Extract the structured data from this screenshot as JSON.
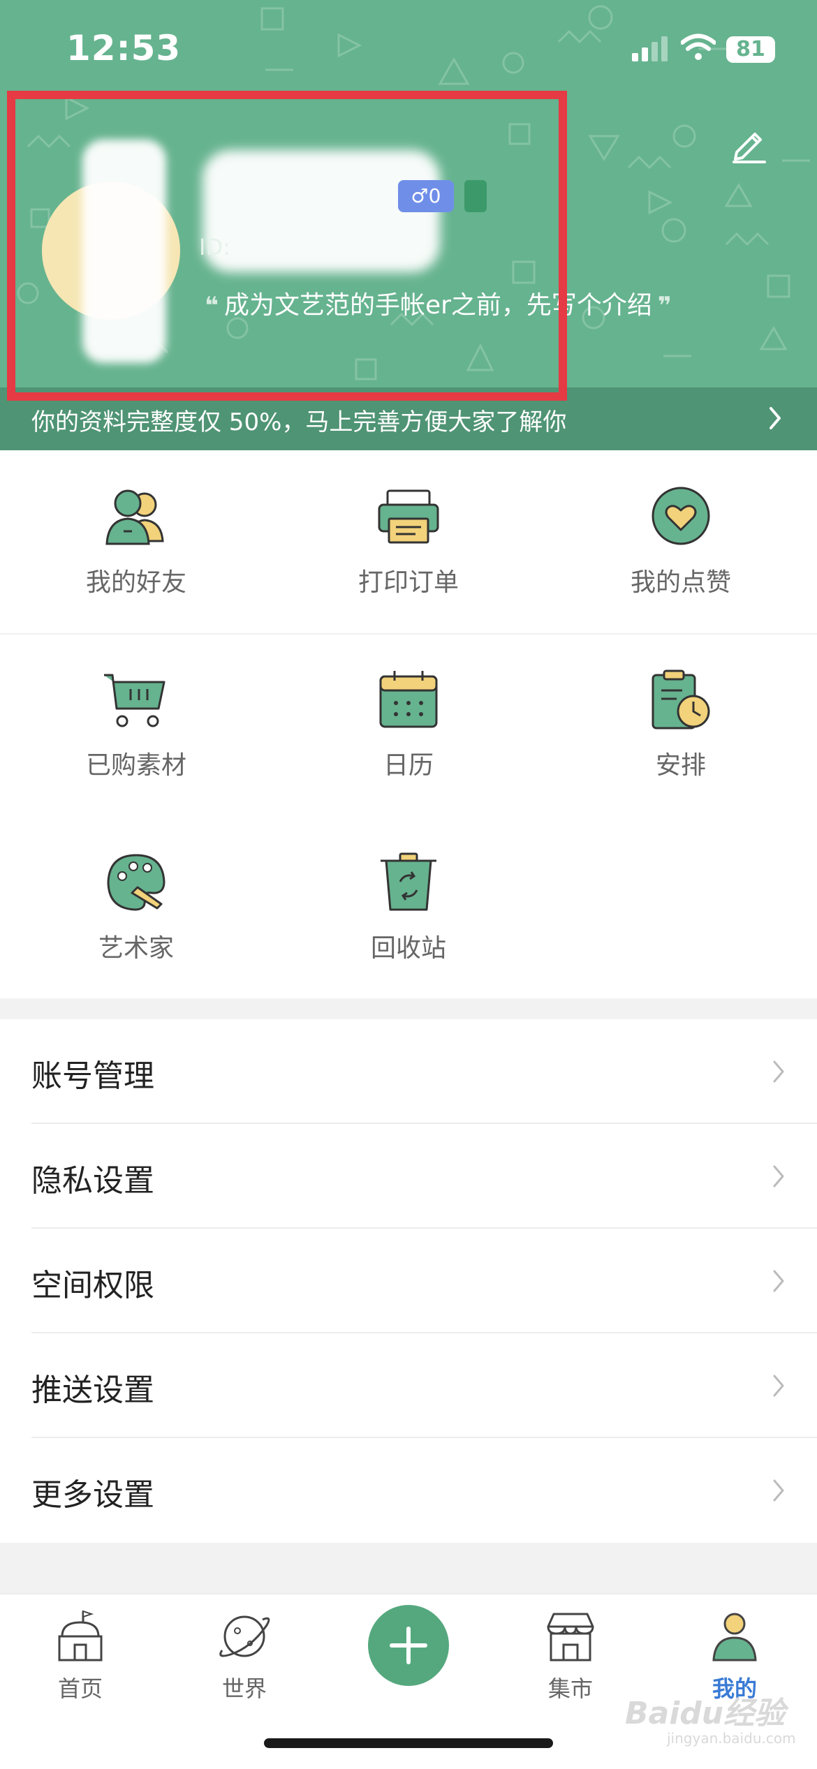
{
  "status": {
    "time": "12:53",
    "battery": "81"
  },
  "profile": {
    "id_prefix": "ID:",
    "gender_badge": "♂0",
    "intro_text": "成为文艺范的手帐er之前，先写个介绍",
    "quote_open": "❝",
    "quote_close": "❞"
  },
  "banner": {
    "text": "你的资料完整度仅 50%，马上完善方便大家了解你"
  },
  "grid": [
    {
      "label": "我的好友",
      "icon": "friends-icon"
    },
    {
      "label": "打印订单",
      "icon": "printer-icon"
    },
    {
      "label": "我的点赞",
      "icon": "heart-icon"
    },
    {
      "label": "已购素材",
      "icon": "cart-icon"
    },
    {
      "label": "日历",
      "icon": "calendar-icon"
    },
    {
      "label": "安排",
      "icon": "clipboard-clock-icon"
    },
    {
      "label": "艺术家",
      "icon": "palette-icon"
    },
    {
      "label": "回收站",
      "icon": "recycle-bin-icon"
    }
  ],
  "settings": [
    {
      "label": "账号管理"
    },
    {
      "label": "隐私设置"
    },
    {
      "label": "空间权限"
    },
    {
      "label": "推送设置"
    },
    {
      "label": "更多设置"
    }
  ],
  "tabs": [
    {
      "label": "首页",
      "icon": "home-icon"
    },
    {
      "label": "世界",
      "icon": "planet-icon"
    },
    {
      "label": "",
      "icon": "plus-icon"
    },
    {
      "label": "集市",
      "icon": "market-icon"
    },
    {
      "label": "我的",
      "icon": "profile-icon"
    }
  ],
  "colors": {
    "brand_green": "#66b38f",
    "active_tab": "#3a7bd5",
    "highlight_box": "#e63a44"
  },
  "watermark": {
    "text": "Baidu经验",
    "sub": "jingyan.baidu.com"
  }
}
